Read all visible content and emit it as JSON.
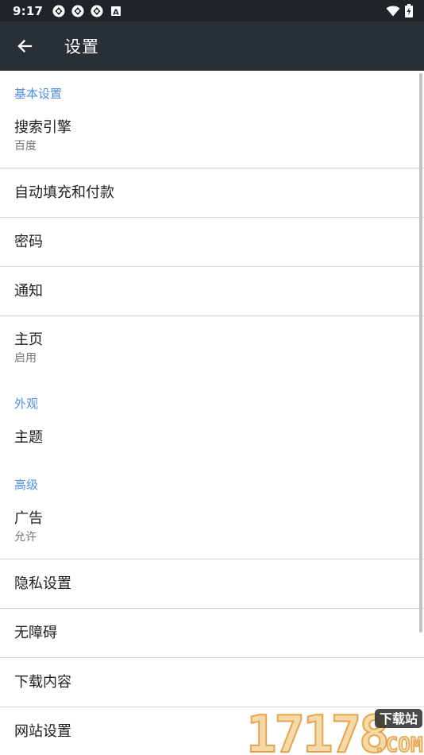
{
  "status_bar": {
    "time": "9:17",
    "left_icons": [
      "app-notification-icon",
      "app-notification-icon",
      "app-notification-icon",
      "a-badge-icon"
    ],
    "right_icons": [
      "wifi-icon",
      "battery-charging-icon"
    ],
    "badge_letter": "A"
  },
  "app_bar": {
    "title": "设置",
    "back_icon": "arrow-left-icon",
    "background": "#283036"
  },
  "accent_color": "#4f8fe8",
  "sections": {
    "basic": {
      "header": "基本设置",
      "search_engine": {
        "title": "搜索引擎",
        "subtitle": "百度"
      },
      "autofill": {
        "title": "自动填充和付款"
      },
      "passwords": {
        "title": "密码"
      },
      "notifications": {
        "title": "通知"
      },
      "homepage": {
        "title": "主页",
        "subtitle": "启用"
      }
    },
    "appearance": {
      "header": "外观",
      "theme": {
        "title": "主题"
      }
    },
    "advanced": {
      "header": "高级",
      "ads": {
        "title": "广告",
        "subtitle": "允许"
      },
      "privacy": {
        "title": "隐私设置"
      },
      "accessibility": {
        "title": "无障碍"
      },
      "downloads": {
        "title": "下载内容"
      },
      "site_settings": {
        "title": "网站设置"
      }
    }
  },
  "watermark": {
    "numbers": "17178",
    "tag": "下载站",
    "domain": ".COM"
  }
}
